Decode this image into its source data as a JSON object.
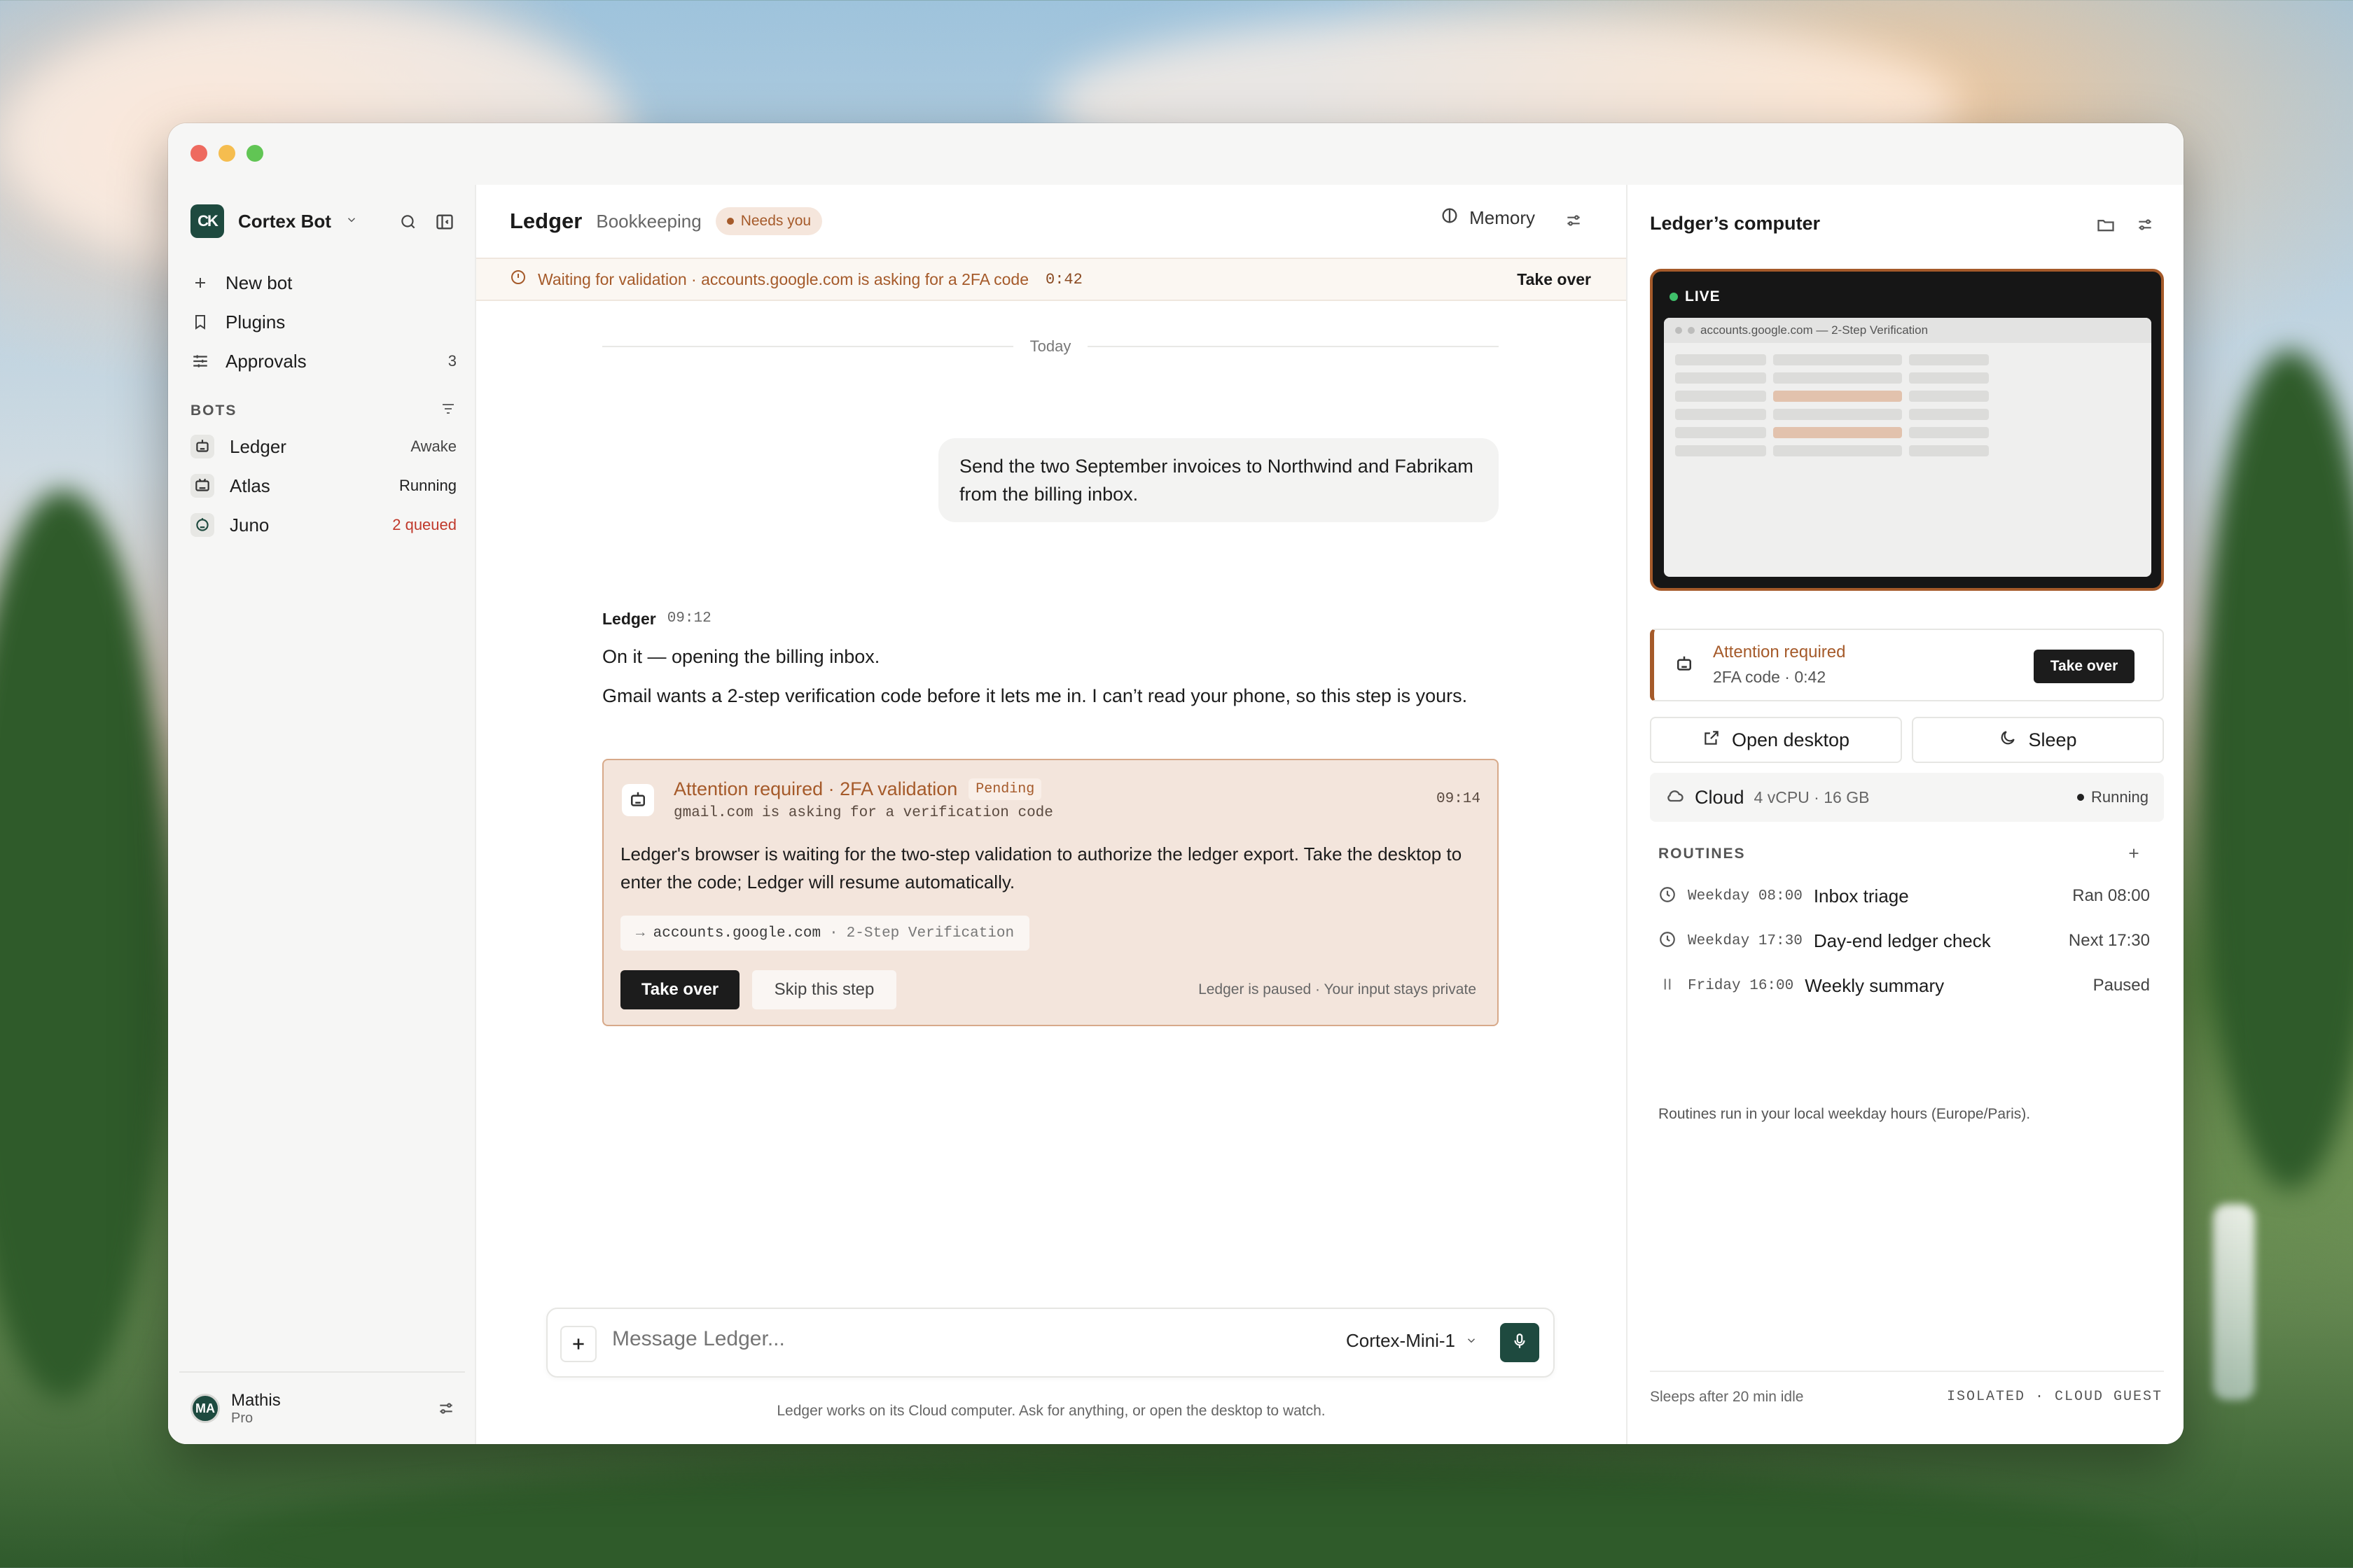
{
  "sidebar": {
    "workspace_logo": "CK",
    "workspace_name": "Cortex Bot",
    "nav": [
      {
        "label": "New bot",
        "icon": "plus-icon"
      },
      {
        "label": "Plugins",
        "icon": "bookmark-icon"
      },
      {
        "label": "Approvals",
        "icon": "sliders-icon",
        "count": "3"
      }
    ],
    "bots_header": "BOTS",
    "bots": [
      {
        "name": "Ledger",
        "status": "Awake"
      },
      {
        "name": "Atlas",
        "status": "Running"
      },
      {
        "name": "Juno",
        "status": "2 queued"
      }
    ],
    "user": {
      "initials": "MA",
      "name": "Mathis",
      "plan": "Pro"
    }
  },
  "header": {
    "bot_name": "Ledger",
    "bot_role": "Bookkeeping",
    "badge": "Needs you",
    "memory_label": "Memory"
  },
  "alert": {
    "text": "Waiting for validation · accounts.google.com is asking for a 2FA code",
    "timer": "0:42",
    "action": "Take over"
  },
  "chat": {
    "day_label": "Today",
    "user_message": "Send the two September invoices to Northwind and Fabrikam from the billing inbox.",
    "bot_name": "Ledger",
    "bot_time": "09:12",
    "bot_lines": [
      "On it — opening the billing inbox.",
      "Gmail wants a 2-step verification code before it lets me in. I can’t read your phone, so this step is yours."
    ]
  },
  "attention_card": {
    "title": "Attention required · 2FA validation",
    "badge": "Pending",
    "subtitle": "gmail.com is asking for a verification code",
    "time": "09:14",
    "body": "Ledger's browser is waiting for the two-step validation to authorize the ledger export. Take the desktop to enter the code; Ledger will resume automatically.",
    "url_arrow": "→",
    "url_host": "accounts.google.com",
    "url_sep": "·",
    "url_path": "2-Step Verification",
    "take_over": "Take over",
    "skip": "Skip this step",
    "note": "Ledger is paused · Your input stays private"
  },
  "composer": {
    "placeholder": "Message Ledger...",
    "model": "Cortex-Mini-1",
    "hint": "Ledger works on its Cloud computer. Ask for anything, or open the desktop to watch."
  },
  "computer": {
    "title": "Ledger’s computer",
    "live_label": "LIVE",
    "screen_title": "accounts.google.com — 2-Step Verification",
    "attention_title": "Attention required",
    "attention_sub": "2FA code · 0:42",
    "attention_btn": "Take over",
    "open_desktop": "Open desktop",
    "sleep": "Sleep",
    "cloud_name": "Cloud",
    "cloud_spec": "4 vCPU · 16 GB",
    "cloud_status": "Running",
    "routines_header": "ROUTINES",
    "routines": [
      {
        "when": "Weekday 08:00",
        "name": "Inbox triage",
        "status": "Ran 08:00",
        "icon": "clock-icon"
      },
      {
        "when": "Weekday 17:30",
        "name": "Day-end ledger check",
        "status": "Next 17:30",
        "icon": "clock-icon"
      },
      {
        "when": "Friday 16:00",
        "name": "Weekly summary",
        "status": "Paused",
        "icon": "pause-icon"
      }
    ],
    "routines_note": "Routines run in your local weekday hours (Europe/Paris).",
    "footer_left": "Sleeps after 20 min idle",
    "footer_right": "ISOLATED · CLOUD GUEST"
  },
  "colors": {
    "accent": "#a55a2a",
    "brand": "#1e4a3f",
    "attention_bg": "#f3e5dc"
  }
}
